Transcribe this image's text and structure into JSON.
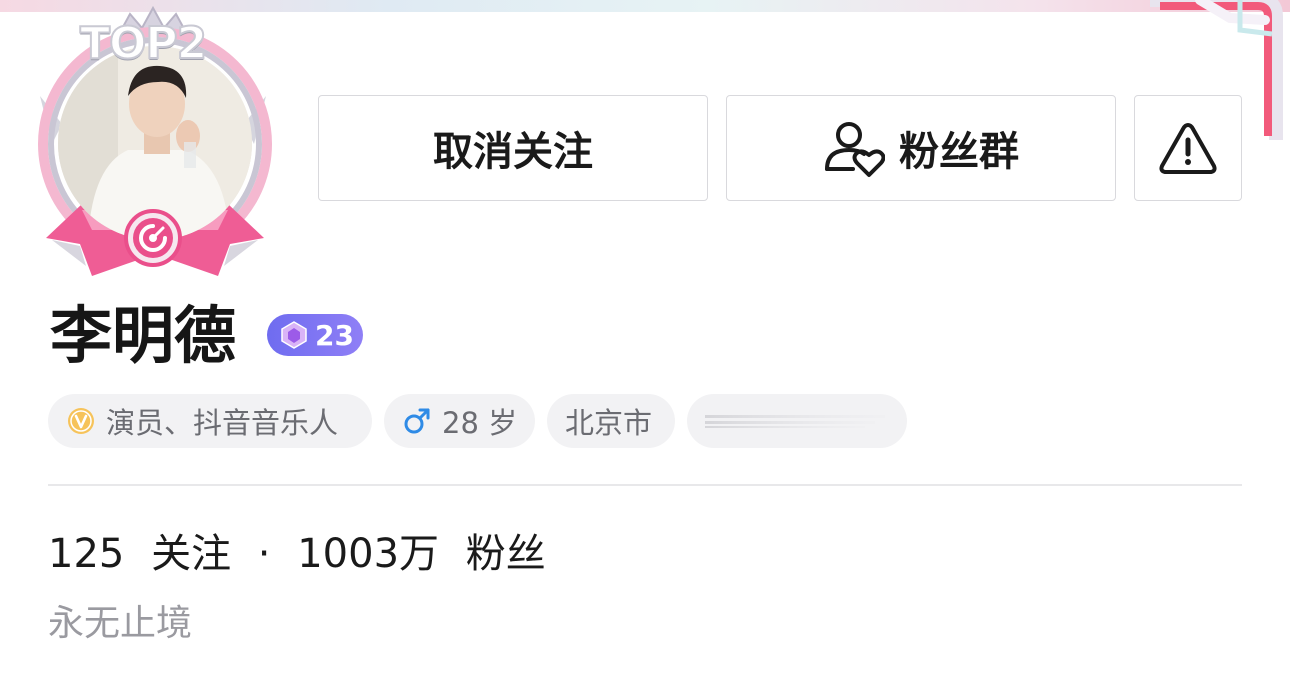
{
  "avatar": {
    "rank_badge": "TOP2"
  },
  "actions": {
    "unfollow_label": "取消关注",
    "fan_group_label": "粉丝群",
    "report_icon": "warning-triangle-icon"
  },
  "profile": {
    "name": "李明德",
    "level": "23",
    "tags": {
      "verify": "演员、抖音音乐人",
      "age": "28 岁",
      "city": "北京市"
    },
    "following_count": "125",
    "following_label": "关注",
    "separator": "·",
    "followers_count": "1003万",
    "followers_label": "粉丝",
    "bio": "永无止境"
  },
  "colors": {
    "level_badge": "#7b74f2",
    "verify_icon": "#f0b43c",
    "male_icon": "#2f8be6",
    "frame_pink": "#ef5d95"
  }
}
